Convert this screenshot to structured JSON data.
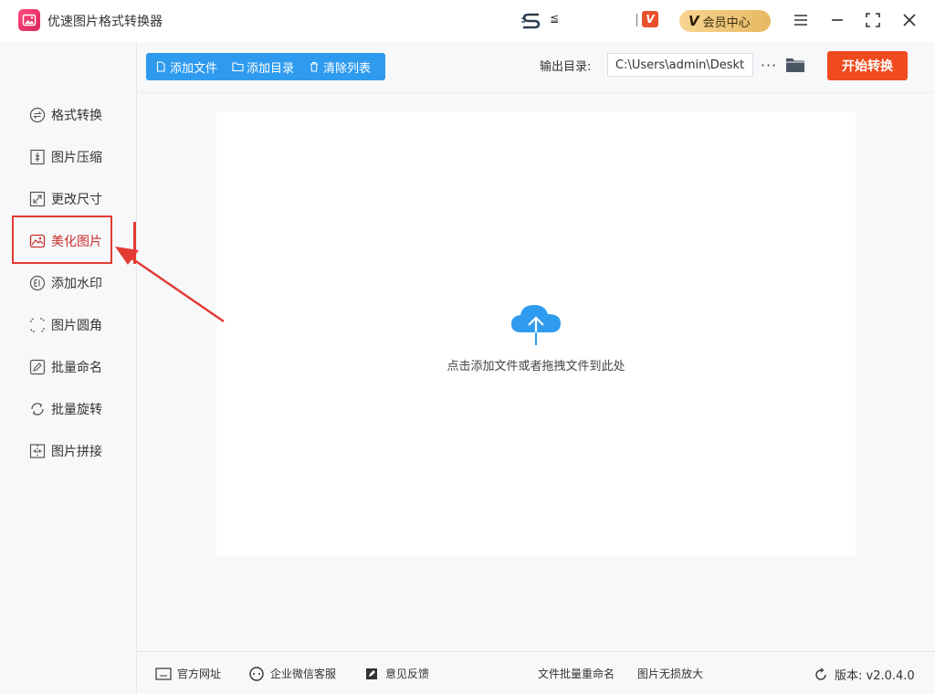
{
  "app": {
    "title": "优速图片格式转换器",
    "glyph": "≦",
    "vip_label": "会员中心"
  },
  "sidebar": {
    "items": [
      {
        "label": "格式转换"
      },
      {
        "label": "图片压缩"
      },
      {
        "label": "更改尺寸"
      },
      {
        "label": "美化图片"
      },
      {
        "label": "添加水印"
      },
      {
        "label": "图片圆角"
      },
      {
        "label": "批量命名"
      },
      {
        "label": "批量旋转"
      },
      {
        "label": "图片拼接"
      }
    ],
    "active_index": 3
  },
  "toolbar": {
    "add_file": "添加文件",
    "add_folder": "添加目录",
    "clear_list": "清除列表",
    "output_label": "输出目录:",
    "output_path": "C:\\Users\\admin\\Deskto",
    "more": "···",
    "start": "开始转换"
  },
  "main": {
    "drop_hint": "点击添加文件或者拖拽文件到此处"
  },
  "footer": {
    "website": "官方网址",
    "wechat": "企业微信客服",
    "feedback": "意见反馈",
    "rename": "文件批量重命名",
    "enlarge": "图片无损放大",
    "version": "版本: v2.0.4.0"
  },
  "colors": {
    "primary": "#2f9bef",
    "start": "#f04a1f",
    "highlight": "#e33a34",
    "vip_gold": "#e8b863"
  }
}
